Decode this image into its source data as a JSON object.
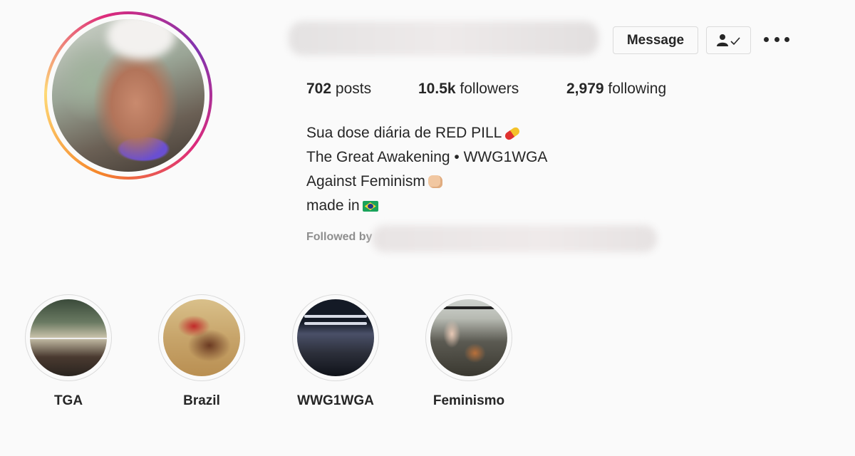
{
  "profile": {
    "posts_count": "702",
    "posts_label": "posts",
    "followers_count": "10.5k",
    "followers_label": "followers",
    "following_count": "2,979",
    "following_label": "following"
  },
  "actions": {
    "message_label": "Message"
  },
  "bio": {
    "line1": "Sua dose diária de RED PILL",
    "line2": "The Great Awakening • WWG1WGA",
    "line3": "Against Feminism",
    "line4": "made in"
  },
  "followed_by_label": "Followed by",
  "highlights": [
    {
      "label": "TGA"
    },
    {
      "label": "Brazil"
    },
    {
      "label": "WWG1WGA"
    },
    {
      "label": "Feminismo"
    }
  ],
  "icons": {
    "more": "more-horizontal-icon",
    "following": "person-check-icon"
  }
}
